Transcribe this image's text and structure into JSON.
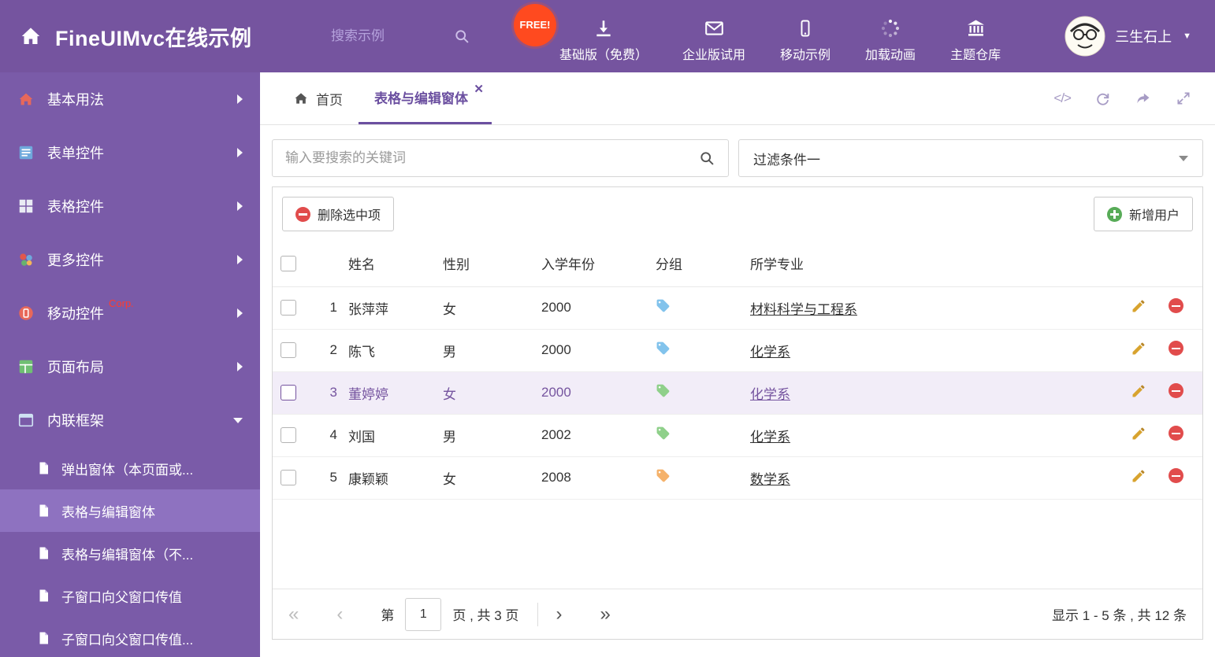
{
  "header": {
    "title": "FineUIMvc在线示例",
    "search_placeholder": "搜索示例",
    "free_badge": "FREE!",
    "nav": [
      {
        "label": "基础版（免费）"
      },
      {
        "label": "企业版试用"
      },
      {
        "label": "移动示例"
      },
      {
        "label": "加载动画"
      },
      {
        "label": "主题仓库"
      }
    ],
    "user": {
      "name": "三生石上"
    }
  },
  "sidebar": {
    "items": [
      {
        "label": "基本用法"
      },
      {
        "label": "表单控件"
      },
      {
        "label": "表格控件"
      },
      {
        "label": "更多控件"
      },
      {
        "label": "移动控件",
        "badge": "Corp."
      },
      {
        "label": "页面布局"
      },
      {
        "label": "内联框架"
      }
    ],
    "subitems": [
      {
        "label": "弹出窗体（本页面或..."
      },
      {
        "label": "表格与编辑窗体"
      },
      {
        "label": "表格与编辑窗体（不..."
      },
      {
        "label": "子窗口向父窗口传值"
      },
      {
        "label": "子窗口向父窗口传值..."
      }
    ]
  },
  "tabs": {
    "home": "首页",
    "active": "表格与编辑窗体"
  },
  "filters": {
    "search_placeholder": "输入要搜索的关键词",
    "dropdown_value": "过滤条件一"
  },
  "toolbar": {
    "delete_label": "删除选中项",
    "add_label": "新增用户"
  },
  "grid": {
    "columns": [
      "姓名",
      "性别",
      "入学年份",
      "分组",
      "所学专业"
    ],
    "rows": [
      {
        "index": "1",
        "name": "张萍萍",
        "gender": "女",
        "year": "2000",
        "tag_color": "#82c3ec",
        "major": "材料科学与工程系"
      },
      {
        "index": "2",
        "name": "陈飞",
        "gender": "男",
        "year": "2000",
        "tag_color": "#82c3ec",
        "major": "化学系"
      },
      {
        "index": "3",
        "name": "董婷婷",
        "gender": "女",
        "year": "2000",
        "tag_color": "#8fd08a",
        "major": "化学系"
      },
      {
        "index": "4",
        "name": "刘国",
        "gender": "男",
        "year": "2002",
        "tag_color": "#8fd08a",
        "major": "化学系"
      },
      {
        "index": "5",
        "name": "康颖颖",
        "gender": "女",
        "year": "2008",
        "tag_color": "#f5b26b",
        "major": "数学系"
      }
    ]
  },
  "pagination": {
    "prefix": "第",
    "page": "1",
    "suffix": "页 , 共 3 页",
    "summary": "显示 1 - 5 条 , 共 12 条"
  },
  "colors": {
    "header_purple": "#75549f",
    "sidebar_purple": "#7a5ba8",
    "accent": "#6b4fa0",
    "selected_row": "#f2edf8",
    "delete_red": "#e14c4c",
    "add_green": "#57ab57",
    "free_badge": "#ff4a1f"
  }
}
